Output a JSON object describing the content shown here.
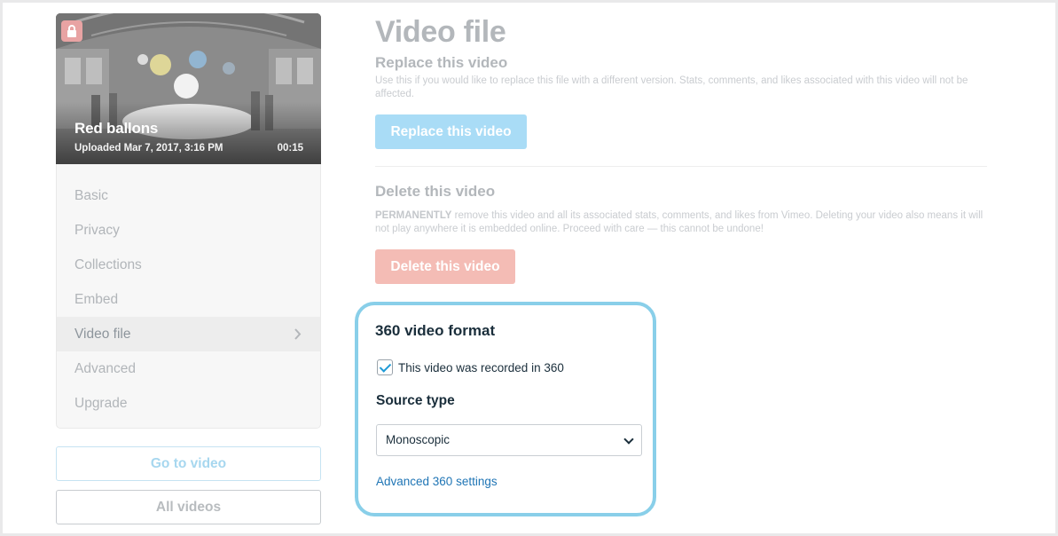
{
  "video": {
    "title": "Red ballons",
    "uploaded": "Uploaded Mar 7, 2017, 3:16 PM",
    "duration": "00:15"
  },
  "menu": {
    "items": [
      {
        "label": "Basic"
      },
      {
        "label": "Privacy"
      },
      {
        "label": "Collections"
      },
      {
        "label": "Embed"
      },
      {
        "label": "Video file",
        "active": true
      },
      {
        "label": "Advanced"
      },
      {
        "label": "Upgrade"
      }
    ]
  },
  "buttons": {
    "go_to_video": "Go to video",
    "all_videos": "All videos"
  },
  "main": {
    "title": "Video file",
    "replace": {
      "heading": "Replace this video",
      "description": "Use this if you would like to replace this file with a different version. Stats, comments, and likes associated with this video will not be affected.",
      "button": "Replace this video"
    },
    "delete": {
      "heading": "Delete this video",
      "description_strong": "PERMANENTLY",
      "description": " remove this video and all its associated stats, comments, and likes from Vimeo. Deleting your video also means it will not play anywhere it is embedded online. Proceed with care — this cannot be undone!",
      "button": "Delete this video"
    }
  },
  "panel360": {
    "title": "360 video format",
    "checkbox_label": "This video was recorded in 360",
    "checkbox_checked": true,
    "source_label": "Source type",
    "source_value": "Monoscopic",
    "advanced_link": "Advanced 360 settings"
  },
  "colors": {
    "accent_blue": "#1f75b5",
    "panel_border": "#89cfe9",
    "replace_button": "#a9dcf6",
    "delete_button": "#f4bcb5"
  },
  "icons": {
    "lock": "lock-icon",
    "chevron": "chevron-right-icon",
    "dropdown": "chevron-down-icon",
    "check": "checkmark-icon"
  }
}
